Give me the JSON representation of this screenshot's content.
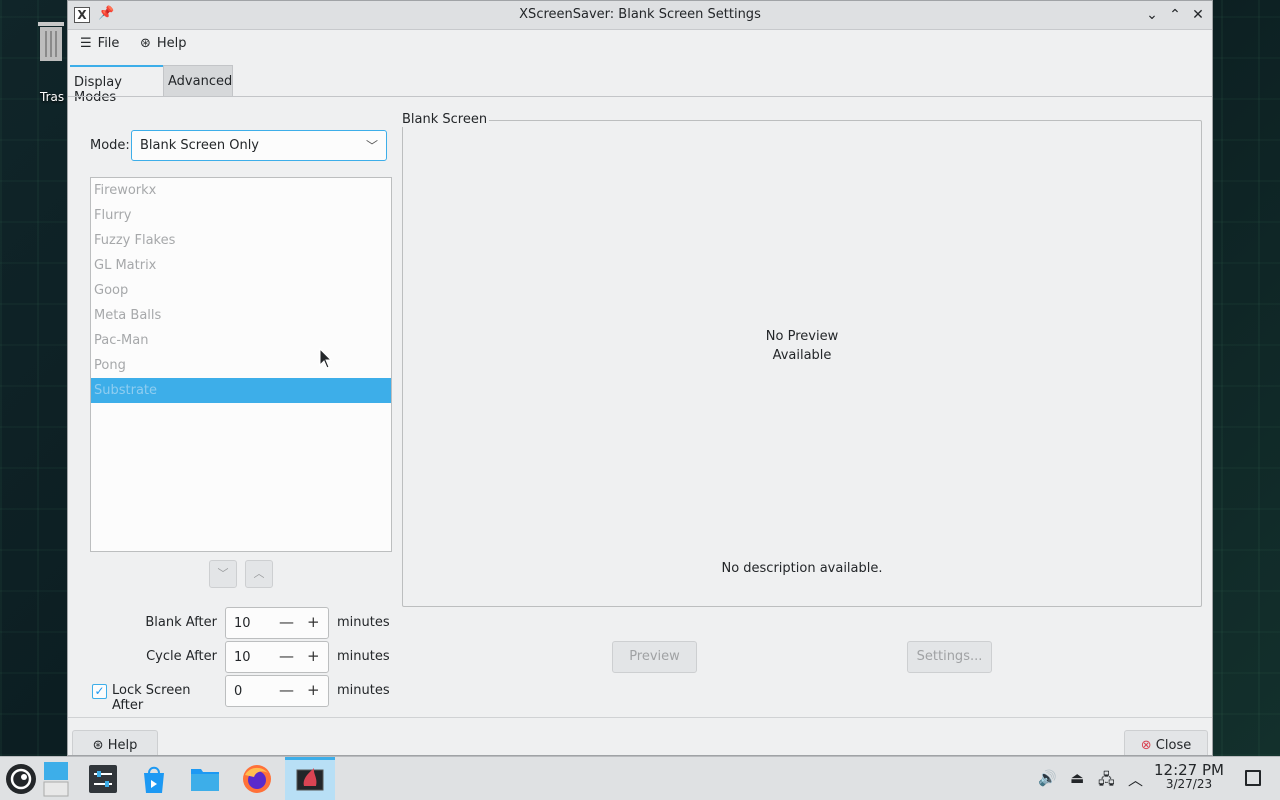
{
  "desktop": {
    "trash_label": "Tras"
  },
  "window": {
    "title": "XScreenSaver: Blank Screen Settings",
    "menu": {
      "file": "File",
      "help": "Help"
    },
    "tabs": [
      {
        "label": "Display Modes"
      },
      {
        "label": "Advanced"
      }
    ],
    "mode": {
      "label": "Mode:",
      "value": "Blank Screen Only"
    },
    "list_items": [
      {
        "label": "Fireworkx"
      },
      {
        "label": "Flurry"
      },
      {
        "label": "Fuzzy Flakes"
      },
      {
        "label": "GL Matrix"
      },
      {
        "label": "Goop"
      },
      {
        "label": "Meta Balls"
      },
      {
        "label": "Pac-Man"
      },
      {
        "label": "Pong"
      },
      {
        "label": "Substrate"
      }
    ],
    "fields": {
      "blank_after": {
        "label": "Blank After",
        "value": "10",
        "unit": "minutes"
      },
      "cycle_after": {
        "label": "Cycle After",
        "value": "10",
        "unit": "minutes"
      },
      "lock_after": {
        "label": "Lock Screen After",
        "value": "0",
        "unit": "minutes",
        "checked": true
      }
    },
    "preview": {
      "group_title": "Blank Screen",
      "no_preview_line1": "No Preview",
      "no_preview_line2": "Available",
      "no_description": "No description available.",
      "preview_button": "Preview",
      "settings_button": "Settings..."
    },
    "footer": {
      "help_button": "Help",
      "close_button": "Close"
    }
  },
  "taskbar": {
    "time": "12:27 PM",
    "date": "3/27/23"
  },
  "colors": {
    "accent": "#3daee9",
    "window_bg": "#eff0f1",
    "close_red": "#da4453"
  }
}
